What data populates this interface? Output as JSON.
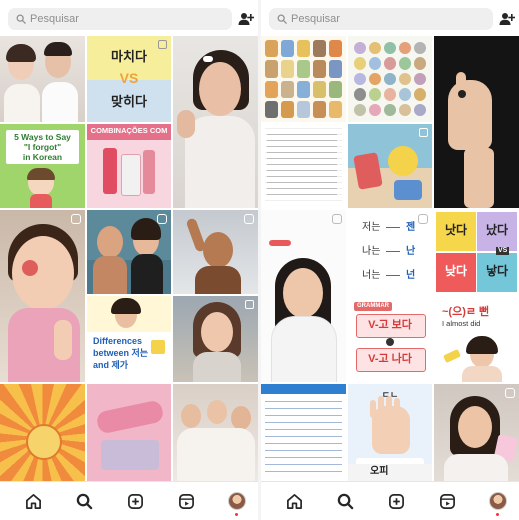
{
  "search": {
    "placeholder": "Pesquisar"
  },
  "left": {
    "tiles": [
      {
        "title": "",
        "subtitle": ""
      },
      {
        "word_top": "마치다",
        "vs": "VS",
        "word_bottom": "맞히다"
      },
      {
        "caption": ""
      },
      {
        "lines": [
          "5 Ways to Say",
          "\"I forgot\"",
          "in Korean"
        ]
      },
      {
        "header": "COMBINAÇÕES COM"
      },
      {
        "caption": ""
      },
      {
        "caption": ""
      },
      {
        "caption": ""
      },
      {
        "caption": ""
      },
      {
        "caption": ""
      },
      {
        "lines": [
          "Differences",
          "between 저는",
          "and 제가"
        ]
      },
      {
        "caption": ""
      },
      {
        "caption": ""
      },
      {
        "caption": ""
      },
      {
        "caption": ""
      }
    ]
  },
  "right": {
    "tiles": [
      {
        "caption": ""
      },
      {
        "caption": ""
      },
      {
        "caption": ""
      },
      {
        "caption": ""
      },
      {
        "caption": ""
      },
      {
        "rows": [
          [
            "저는",
            "젠"
          ],
          [
            "나는",
            "난"
          ],
          [
            "너는",
            "넌"
          ]
        ]
      },
      {
        "cells": [
          "낫다",
          "났다",
          "낮다",
          "낳다"
        ],
        "vs": "VS"
      },
      {
        "label": "GRAMMAR",
        "line1": "V-고 보다",
        "line2": "V-고 나다"
      },
      {
        "title": "~(으)ㄹ 뻔",
        "sub": "I almost did"
      },
      {
        "caption": ""
      },
      {
        "title": "ㄷㄴ",
        "sub": ""
      },
      {
        "caption": ""
      },
      {
        "word": "오피"
      }
    ]
  },
  "colors": {
    "accent": "#f4d34a",
    "nav_icon": "#262626",
    "search_bg": "#efefef"
  },
  "nav_icons": [
    "home-icon",
    "search-icon",
    "create-icon",
    "reels-icon",
    "profile-avatar"
  ]
}
